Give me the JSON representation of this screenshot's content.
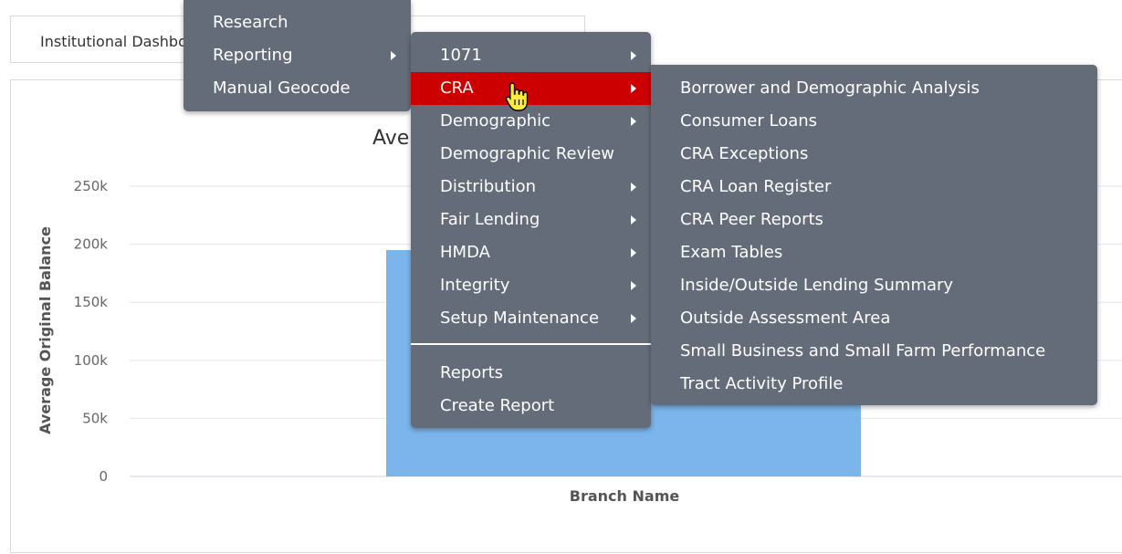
{
  "dashboard_tab": {
    "label": "Institutional Dashboard"
  },
  "chart_data": {
    "type": "bar",
    "title": "Ave",
    "xlabel": "Branch Name",
    "ylabel": "Average Original Balance",
    "y_ticks": [
      "0",
      "50k",
      "100k",
      "150k",
      "200k",
      "250k"
    ],
    "ylim": [
      0,
      250000
    ],
    "categories": [
      ""
    ],
    "values": [
      195000
    ],
    "bar_color": "#7cb5ec",
    "grid": true
  },
  "menu_level1": {
    "items": [
      {
        "label": "Research",
        "has_submenu": false
      },
      {
        "label": "Reporting",
        "has_submenu": true
      },
      {
        "label": "Manual Geocode",
        "has_submenu": false
      }
    ]
  },
  "menu_level2": {
    "items": [
      {
        "label": "1071",
        "has_submenu": true
      },
      {
        "label": "CRA",
        "has_submenu": true,
        "active": true
      },
      {
        "label": "Demographic",
        "has_submenu": true
      },
      {
        "label": "Demographic Review",
        "has_submenu": false
      },
      {
        "label": "Distribution",
        "has_submenu": true
      },
      {
        "label": "Fair Lending",
        "has_submenu": true
      },
      {
        "label": "HMDA",
        "has_submenu": true
      },
      {
        "label": "Integrity",
        "has_submenu": true
      },
      {
        "label": "Setup Maintenance",
        "has_submenu": true
      }
    ],
    "footer_items": [
      {
        "label": "Reports"
      },
      {
        "label": "Create Report"
      }
    ]
  },
  "menu_level3": {
    "items": [
      {
        "label": "Borrower and Demographic Analysis"
      },
      {
        "label": "Consumer Loans"
      },
      {
        "label": "CRA Exceptions"
      },
      {
        "label": "CRA Loan Register"
      },
      {
        "label": "CRA Peer Reports"
      },
      {
        "label": "Exam Tables"
      },
      {
        "label": "Inside/Outside Lending Summary"
      },
      {
        "label": "Outside Assessment Area"
      },
      {
        "label": "Small Business and Small Farm Performance"
      },
      {
        "label": "Tract Activity Profile"
      }
    ]
  },
  "colors": {
    "menu_bg": "#646c79",
    "active_bg": "#cc0000",
    "bar": "#7cb5ec"
  },
  "cursor": {
    "icon": "hand-pointer-icon"
  }
}
